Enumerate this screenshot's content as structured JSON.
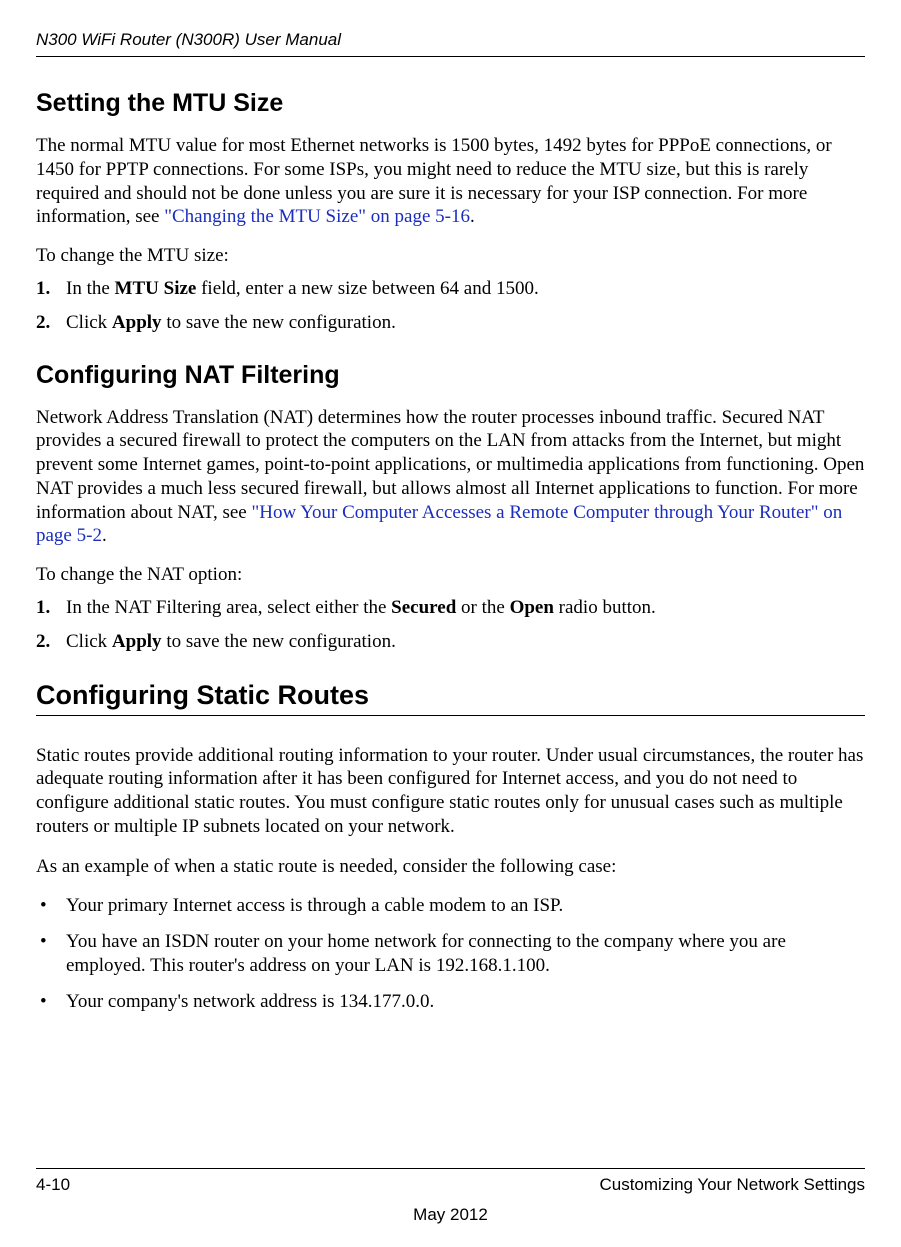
{
  "header": {
    "running_title": "N300 WiFi Router (N300R) User Manual"
  },
  "section_mtu": {
    "heading": "Setting the MTU Size",
    "para1_part1": "The normal MTU value for most Ethernet networks is 1500 bytes, 1492 bytes for PPPoE connections, or 1450 for PPTP connections. For some ISPs, you might need to reduce the MTU size, but this is rarely required and should not be done unless you are sure it is necessary for your ISP connection. For more information, see ",
    "para1_link": "\"Changing the MTU Size\" on page 5-16",
    "para1_part2": ".",
    "lead": "To change the MTU size:",
    "step1_num": "1.",
    "step1_a": "In the ",
    "step1_bold": "MTU Size",
    "step1_b": " field, enter a new size between 64 and 1500.",
    "step2_num": "2.",
    "step2_a": "Click ",
    "step2_bold": "Apply",
    "step2_b": " to save the new configuration."
  },
  "section_nat": {
    "heading": "Configuring NAT Filtering",
    "para1_part1": "Network Address Translation (NAT) determines how the router processes inbound traffic. Secured NAT provides a secured firewall to protect the computers on the LAN from attacks from the Internet, but might prevent some Internet games, point-to-point applications, or multimedia applications from functioning. Open NAT provides a much less secured firewall, but allows almost all Internet applications to function. For more information about NAT, see ",
    "para1_link": "\"How Your Computer Accesses a Remote Computer through Your Router\" on page 5-2",
    "para1_part2": ".",
    "lead": "To change the NAT option:",
    "step1_num": "1.",
    "step1_a": "In the NAT Filtering area, select either the ",
    "step1_bold1": "Secured",
    "step1_b": " or the ",
    "step1_bold2": "Open",
    "step1_c": " radio button.",
    "step2_num": "2.",
    "step2_a": "Click ",
    "step2_bold": "Apply",
    "step2_b": " to save the new configuration."
  },
  "section_static": {
    "heading": "Configuring Static Routes",
    "para1": "Static routes provide additional routing information to your router. Under usual circumstances, the router has adequate routing information after it has been configured for Internet access, and you do not need to configure additional static routes. You must configure static routes only for unusual cases such as multiple routers or multiple IP subnets located on your network.",
    "para2": "As an example of when a static route is needed, consider the following case:",
    "bullets": [
      "Your primary Internet access is through a cable modem to an ISP.",
      "You have an ISDN router on your home network for connecting to the company where you are employed. This router's address on your LAN is 192.168.1.100.",
      "Your company's network address is 134.177.0.0."
    ]
  },
  "footer": {
    "page_number": "4-10",
    "chapter": "Customizing Your Network Settings",
    "date": "May 2012"
  }
}
